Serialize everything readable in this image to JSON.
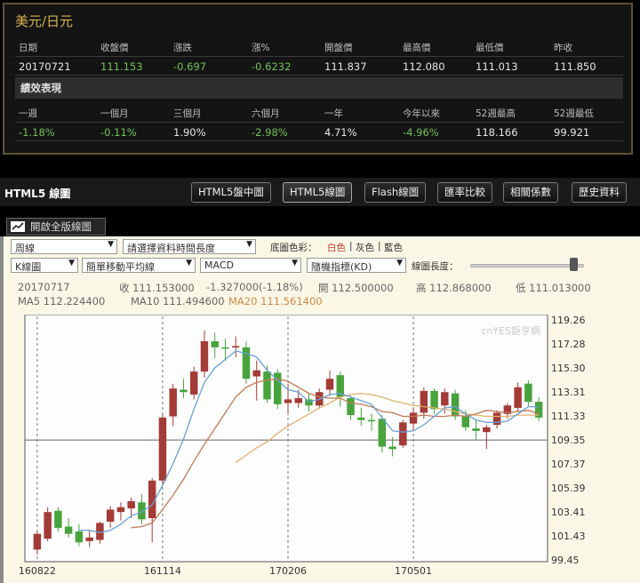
{
  "quote": {
    "title": "美元/日元",
    "headers": [
      "日期",
      "收盤價",
      "漲跌",
      "漲%",
      "開盤價",
      "最高價",
      "最低價",
      "昨收"
    ],
    "values": [
      "20170721",
      "111.153",
      "-0.697",
      "-0.6232",
      "111.837",
      "112.080",
      "111.013",
      "111.850"
    ],
    "perf_title": "績效表現",
    "perf_headers": [
      "一週",
      "一個月",
      "三個月",
      "六個月",
      "一年",
      "今年以來",
      "52週最高",
      "52週最低"
    ],
    "perf_values": [
      "-1.18%",
      "-0.11%",
      "1.90%",
      "-2.98%",
      "4.71%",
      "-4.96%",
      "118.166",
      "99.921"
    ]
  },
  "chart_header": {
    "title": "HTML5 線圖",
    "tabs": [
      "HTML5盤中圖",
      "HTML5線圖",
      "Flash線圖",
      "匯率比較",
      "相關係數",
      "歷史資料"
    ]
  },
  "full_chart_button": "開啟全版線圖",
  "controls": {
    "period": "周線",
    "time_range": "請選擇資料時間長度",
    "bg_label": "底圖色彩：",
    "bg_white": "白色",
    "bg_sep": "|",
    "bg_gray": "灰色",
    "bg_blue": "藍色",
    "chart_type": "K線圖",
    "ma_type": "簡單移動平均線",
    "indicator1": "MACD",
    "indicator2": "隨機指標(KD)",
    "length_label": "線圖長度："
  },
  "info": {
    "date": "20170717",
    "close": "收 111.153000",
    "change": "-1.327000(-1.18%)",
    "open": "開 112.500000",
    "high": "高 112.868000",
    "low": "低 111.013000",
    "ma5": "MA5 112.224400",
    "ma10": "MA10 111.494600",
    "ma20": "MA20 111.561400"
  },
  "colors": {
    "up": "#a33b36",
    "down": "#48a33c",
    "ma5": "#6aa0d8",
    "ma10": "#c07a52",
    "ma20": "#e0b070"
  },
  "chart_data": {
    "type": "candlestick",
    "watermark": "cnYES鉅亨網",
    "ylim": [
      99.45,
      119.26
    ],
    "yticks": [
      119.26,
      117.28,
      115.3,
      113.31,
      111.33,
      109.35,
      107.37,
      105.39,
      103.41,
      101.43,
      99.45
    ],
    "xticks": [
      {
        "index": 0,
        "label": "160822"
      },
      {
        "index": 12,
        "label": "161114"
      },
      {
        "index": 24,
        "label": "170206"
      },
      {
        "index": 36,
        "label": "170501"
      }
    ],
    "reference_line": 109.35,
    "candles": [
      {
        "o": 100.3,
        "h": 101.8,
        "l": 99.9,
        "c": 101.6
      },
      {
        "o": 101.2,
        "h": 103.8,
        "l": 101.0,
        "c": 103.4
      },
      {
        "o": 103.5,
        "h": 103.8,
        "l": 101.8,
        "c": 102.1
      },
      {
        "o": 102.2,
        "h": 102.9,
        "l": 101.3,
        "c": 101.6
      },
      {
        "o": 101.8,
        "h": 102.4,
        "l": 100.6,
        "c": 100.9
      },
      {
        "o": 101.0,
        "h": 101.9,
        "l": 100.5,
        "c": 101.3
      },
      {
        "o": 101.1,
        "h": 102.6,
        "l": 100.8,
        "c": 102.5
      },
      {
        "o": 102.6,
        "h": 103.9,
        "l": 102.1,
        "c": 103.6
      },
      {
        "o": 103.4,
        "h": 104.2,
        "l": 102.7,
        "c": 103.8
      },
      {
        "o": 103.7,
        "h": 104.6,
        "l": 102.9,
        "c": 104.3
      },
      {
        "o": 104.2,
        "h": 104.9,
        "l": 102.4,
        "c": 102.8
      },
      {
        "o": 102.9,
        "h": 106.2,
        "l": 100.9,
        "c": 106.0
      },
      {
        "o": 106.0,
        "h": 111.5,
        "l": 105.7,
        "c": 111.2
      },
      {
        "o": 111.3,
        "h": 114.0,
        "l": 110.5,
        "c": 113.6
      },
      {
        "o": 113.5,
        "h": 114.4,
        "l": 112.8,
        "c": 113.3
      },
      {
        "o": 113.1,
        "h": 115.4,
        "l": 112.7,
        "c": 115.0
      },
      {
        "o": 115.0,
        "h": 118.4,
        "l": 114.5,
        "c": 117.5
      },
      {
        "o": 117.5,
        "h": 118.2,
        "l": 116.1,
        "c": 117.0
      },
      {
        "o": 117.0,
        "h": 117.7,
        "l": 115.9,
        "c": 116.9
      },
      {
        "o": 117.0,
        "h": 117.9,
        "l": 116.2,
        "c": 117.1
      },
      {
        "o": 117.0,
        "h": 117.5,
        "l": 114.0,
        "c": 114.4
      },
      {
        "o": 114.6,
        "h": 115.9,
        "l": 112.6,
        "c": 115.1
      },
      {
        "o": 115.0,
        "h": 115.5,
        "l": 112.4,
        "c": 112.7
      },
      {
        "o": 114.9,
        "h": 115.2,
        "l": 111.9,
        "c": 112.3
      },
      {
        "o": 112.4,
        "h": 114.0,
        "l": 111.4,
        "c": 112.7
      },
      {
        "o": 112.4,
        "h": 113.5,
        "l": 112.0,
        "c": 112.8
      },
      {
        "o": 112.7,
        "h": 113.2,
        "l": 111.7,
        "c": 112.2
      },
      {
        "o": 112.2,
        "h": 113.6,
        "l": 112.0,
        "c": 113.3
      },
      {
        "o": 113.5,
        "h": 115.1,
        "l": 113.0,
        "c": 114.4
      },
      {
        "o": 114.7,
        "h": 115.0,
        "l": 112.1,
        "c": 112.9
      },
      {
        "o": 112.8,
        "h": 113.0,
        "l": 111.0,
        "c": 111.4
      },
      {
        "o": 111.2,
        "h": 112.0,
        "l": 110.5,
        "c": 111.0
      },
      {
        "o": 111.0,
        "h": 111.5,
        "l": 110.1,
        "c": 110.9
      },
      {
        "o": 111.1,
        "h": 111.4,
        "l": 108.3,
        "c": 108.8
      },
      {
        "o": 108.8,
        "h": 109.6,
        "l": 108.0,
        "c": 108.6
      },
      {
        "o": 108.9,
        "h": 111.0,
        "l": 108.7,
        "c": 110.8
      },
      {
        "o": 110.7,
        "h": 112.0,
        "l": 110.2,
        "c": 111.6
      },
      {
        "o": 111.6,
        "h": 113.7,
        "l": 111.1,
        "c": 113.4
      },
      {
        "o": 113.4,
        "h": 113.6,
        "l": 111.5,
        "c": 111.9
      },
      {
        "o": 112.2,
        "h": 113.6,
        "l": 111.5,
        "c": 113.3
      },
      {
        "o": 113.2,
        "h": 113.5,
        "l": 111.0,
        "c": 111.3
      },
      {
        "o": 111.3,
        "h": 111.8,
        "l": 110.1,
        "c": 110.4
      },
      {
        "o": 110.3,
        "h": 111.0,
        "l": 109.3,
        "c": 110.1
      },
      {
        "o": 110.0,
        "h": 110.6,
        "l": 108.6,
        "c": 110.4
      },
      {
        "o": 110.6,
        "h": 111.8,
        "l": 110.3,
        "c": 111.6
      },
      {
        "o": 111.5,
        "h": 112.4,
        "l": 111.1,
        "c": 112.2
      },
      {
        "o": 112.0,
        "h": 114.1,
        "l": 111.7,
        "c": 113.7
      },
      {
        "o": 114.0,
        "h": 114.3,
        "l": 112.1,
        "c": 112.5
      },
      {
        "o": 112.5,
        "h": 112.9,
        "l": 110.9,
        "c": 111.2
      }
    ],
    "ma5": [
      null,
      null,
      null,
      null,
      101.9,
      101.9,
      101.7,
      101.9,
      102.4,
      103.1,
      103.4,
      104.0,
      105.6,
      107.4,
      109.4,
      111.9,
      114.1,
      115.3,
      116.0,
      116.7,
      116.5,
      116.2,
      115.1,
      114.3,
      113.5,
      113.3,
      112.5,
      112.7,
      113.1,
      113.2,
      112.9,
      112.6,
      112.3,
      111.2,
      110.1,
      110.0,
      110.1,
      110.6,
      111.3,
      112.0,
      112.1,
      111.5,
      111.0,
      110.8,
      110.8,
      110.9,
      111.5,
      112.1,
      112.1
    ],
    "ma10": [
      null,
      null,
      null,
      null,
      null,
      null,
      null,
      null,
      null,
      102.1,
      102.2,
      102.5,
      103.6,
      104.8,
      106.1,
      107.6,
      109.0,
      110.3,
      111.6,
      112.9,
      113.7,
      114.1,
      114.3,
      114.4,
      114.2,
      113.7,
      113.2,
      112.9,
      112.8,
      112.8,
      112.4,
      112.3,
      112.1,
      111.7,
      111.6,
      111.3,
      111.3,
      111.4,
      111.3,
      111.3,
      111.4,
      111.3,
      111.5,
      111.8,
      111.7,
      111.6,
      111.7,
      111.8,
      111.5
    ],
    "ma20": [
      null,
      null,
      null,
      null,
      null,
      null,
      null,
      null,
      null,
      null,
      null,
      null,
      null,
      null,
      null,
      null,
      null,
      null,
      null,
      107.5,
      108.1,
      108.7,
      109.2,
      109.9,
      110.5,
      111.0,
      111.5,
      112.0,
      112.4,
      112.9,
      113.1,
      113.2,
      113.1,
      112.9,
      112.6,
      112.4,
      112.2,
      112.1,
      112.0,
      111.9,
      111.7,
      111.5,
      111.4,
      111.3,
      111.3,
      111.3,
      111.4,
      111.4,
      111.4
    ]
  }
}
